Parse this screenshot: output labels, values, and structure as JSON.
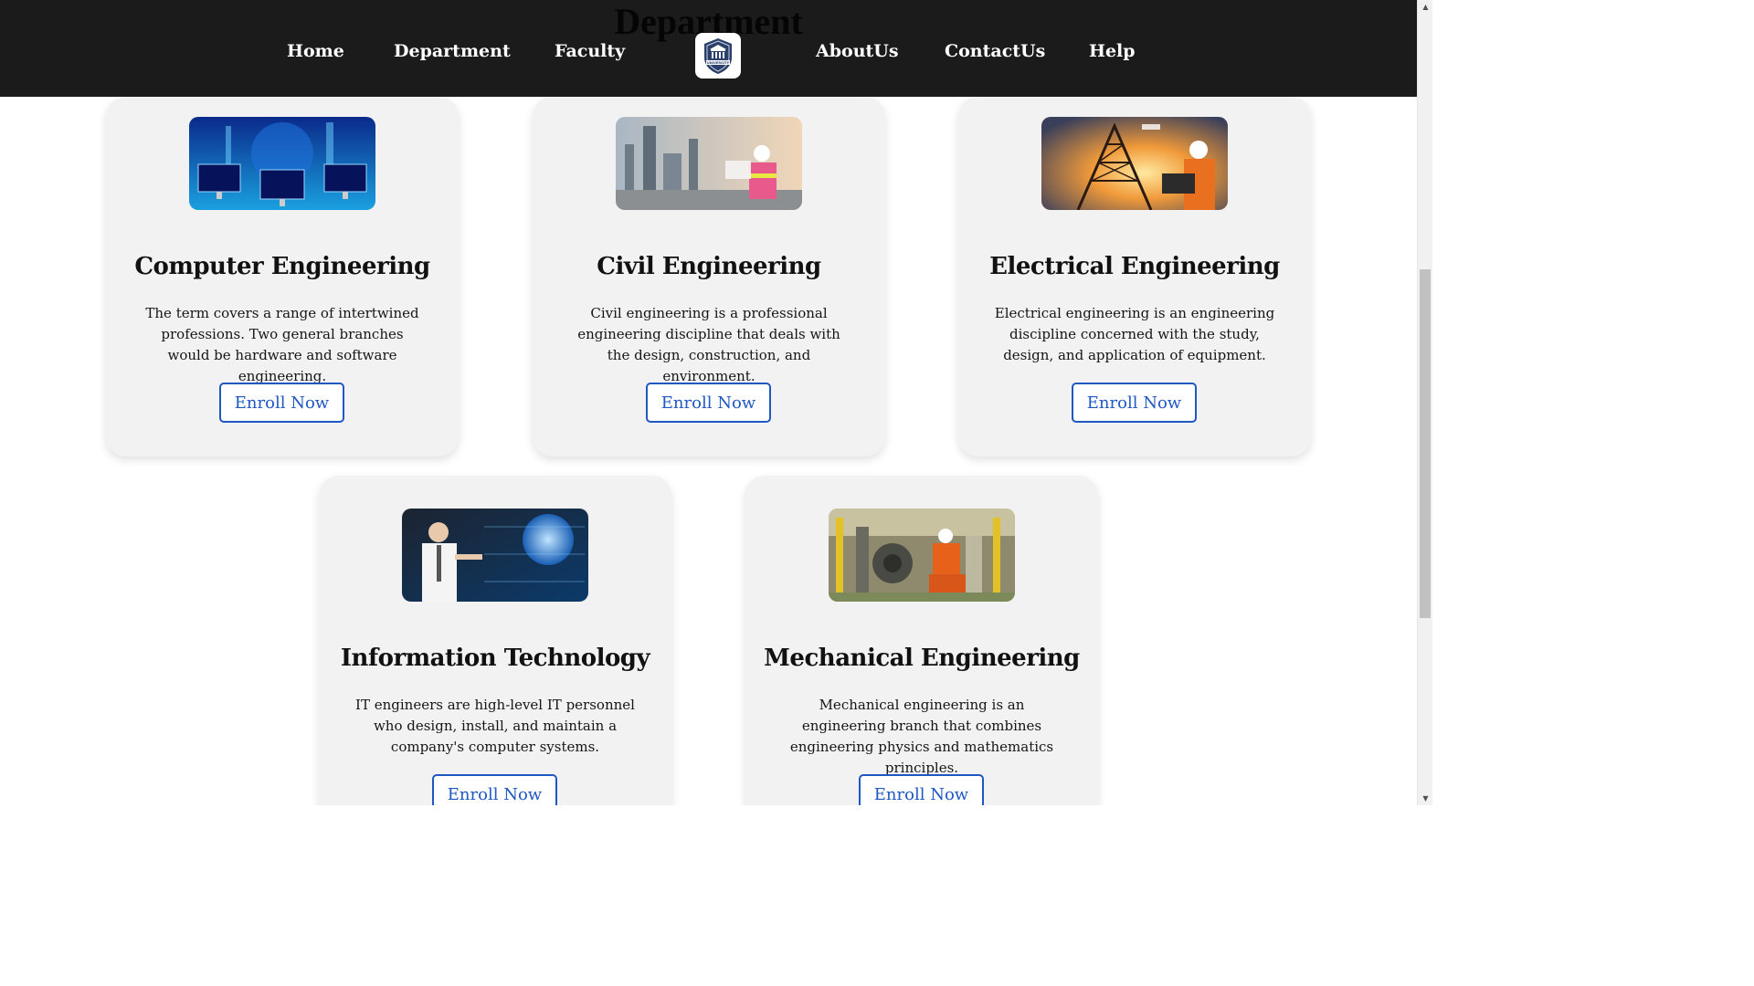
{
  "section": {
    "title": "Department"
  },
  "nav": {
    "items": [
      {
        "label": "Home"
      },
      {
        "label": "Department"
      },
      {
        "label": "Faculty"
      },
      {
        "label": "AboutUs"
      },
      {
        "label": "ContactUs"
      },
      {
        "label": "Help"
      }
    ],
    "logo": {
      "text": "UNIVERSITY",
      "icon": "university-logo-icon"
    }
  },
  "cards": [
    {
      "title": "Computer Engineering",
      "description": "The term covers a range of intertwined professions. Two general branches would be hardware and software engineering.",
      "button": "Enroll Now",
      "image": "computer-monitors-image"
    },
    {
      "title": "Civil Engineering",
      "description": "Civil engineering is a professional engineering discipline that deals with the design, construction, and environment.",
      "button": "Enroll Now",
      "image": "civil-engineer-site-image"
    },
    {
      "title": "Electrical Engineering",
      "description": "Electrical engineering is an engineering discipline concerned with the study, design, and application of equipment.",
      "button": "Enroll Now",
      "image": "power-tower-engineer-image"
    },
    {
      "title": "Information Technology",
      "description": "IT engineers are high-level IT personnel who design, install, and maintain a company's computer systems.",
      "button": "Enroll Now",
      "image": "it-globe-interface-image"
    },
    {
      "title": "Mechanical Engineering",
      "description": "Mechanical engineering is an engineering branch that combines engineering physics and mathematics principles.",
      "button": "Enroll Now",
      "image": "mechanical-plant-worker-image"
    }
  ],
  "colors": {
    "navbar": "#1b1b1b",
    "card": "#f2f2f2",
    "accent": "#1f57c3"
  }
}
